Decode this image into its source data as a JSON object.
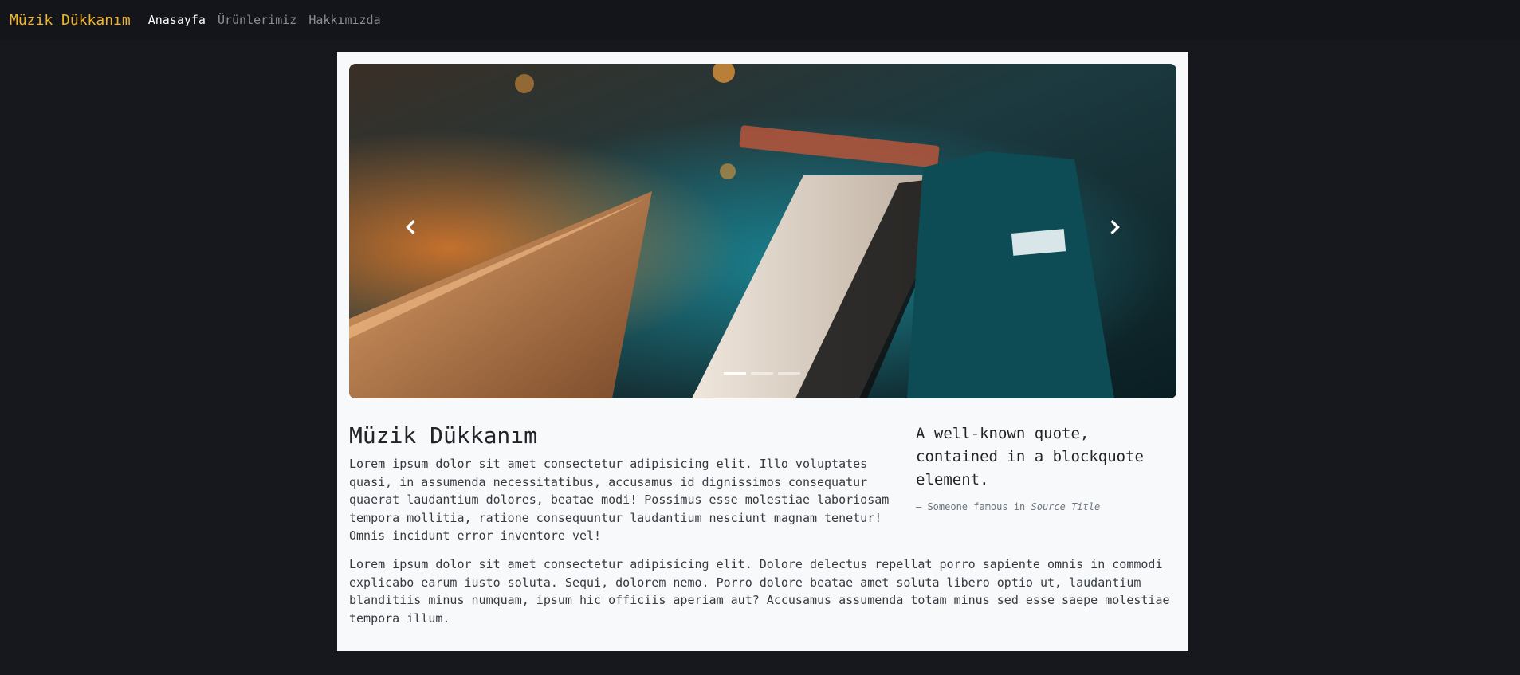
{
  "navbar": {
    "brand": "Müzik Dükkanım",
    "links": [
      {
        "label": "Anasayfa",
        "active": true
      },
      {
        "label": "Ürünlerimiz",
        "active": false
      },
      {
        "label": "Hakkımızda",
        "active": false
      }
    ]
  },
  "carousel": {
    "prev_icon": "chevron-left-icon",
    "next_icon": "chevron-right-icon",
    "indicator_count": 3,
    "active_index": 0
  },
  "article": {
    "title": "Müzik Dükkanım",
    "paragraph1": "Lorem ipsum dolor sit amet consectetur adipisicing elit. Illo voluptates quasi, in assumenda necessitatibus, accusamus id dignissimos consequatur quaerat laudantium dolores, beatae modi! Possimus esse molestiae laboriosam tempora mollitia, ratione consequuntur laudantium nesciunt magnam tenetur! Omnis incidunt error inventore vel!",
    "paragraph2": "Lorem ipsum dolor sit amet consectetur adipisicing elit. Dolore delectus repellat porro sapiente omnis in commodi explicabo earum iusto soluta. Sequi, dolorem nemo. Porro dolore beatae amet soluta libero optio ut, laudantium blanditiis minus numquam, ipsum hic officiis aperiam aut? Accusamus assumenda totam minus sed esse saepe molestiae tempora illum."
  },
  "blockquote": {
    "text": "A well-known quote, contained in a blockquote element.",
    "footer_prefix": "—  Someone famous in ",
    "source_title": "Source Title"
  },
  "colors": {
    "page_bg": "#16181d",
    "navbar_bg": "#13151a",
    "brand": "#f0b429",
    "content_bg": "#f8f9fa"
  }
}
